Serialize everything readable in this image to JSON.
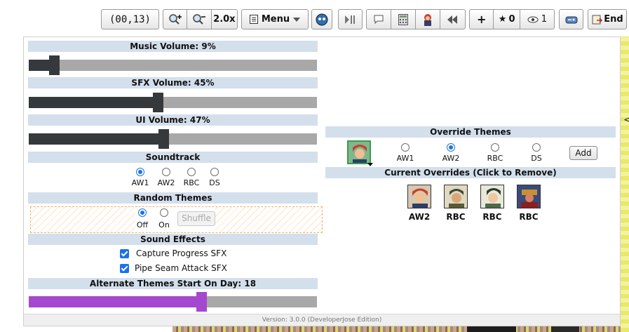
{
  "toolbar": {
    "coordinates": "(00,13)",
    "zoom_in_icon": "zoom-in-icon",
    "zoom_out_icon": "zoom-out-icon",
    "zoom_level": "2.0x",
    "menu_label": "Menu",
    "add_label": "+",
    "stars_count": "0",
    "eye_count": "1",
    "end_label": "End"
  },
  "settings": {
    "music": {
      "label": "Music Volume: 9%",
      "value": 0.09
    },
    "sfx": {
      "label": "SFX Volume: 45%",
      "value": 0.45
    },
    "ui": {
      "label": "UI Volume: 47%",
      "value": 0.47
    },
    "soundtrack": {
      "label": "Soundtrack",
      "options": [
        "AW1",
        "AW2",
        "RBC",
        "DS"
      ],
      "selected": "AW1"
    },
    "random_themes": {
      "label": "Random Themes",
      "off_label": "Off",
      "on_label": "On",
      "selected": "Off",
      "shuffle_label": "Shuffle"
    },
    "sound_effects": {
      "label": "Sound Effects",
      "capture_label": "Capture Progress SFX",
      "capture_checked": true,
      "pipe_label": "Pipe Seam Attack SFX",
      "pipe_checked": true
    },
    "alt_themes": {
      "label": "Alternate Themes Start On Day: 18",
      "value": 0.6
    }
  },
  "override": {
    "label": "Override Themes",
    "options": [
      "AW1",
      "AW2",
      "RBC",
      "DS"
    ],
    "selected": "AW2",
    "add_label": "Add",
    "current_label": "Current Overrides (Click to Remove)",
    "current": [
      "AW2",
      "RBC",
      "RBC",
      "RBC"
    ]
  },
  "footer": {
    "version": "Version: 3.0.0 (DeveloperJose Edition)"
  },
  "colors": {
    "header_bg": "#d4dfec",
    "slider_dark": "#36393b",
    "slider_track": "#a8a8a8",
    "accent_purple": "#a548cf",
    "radio_blue": "#1a73e8"
  }
}
